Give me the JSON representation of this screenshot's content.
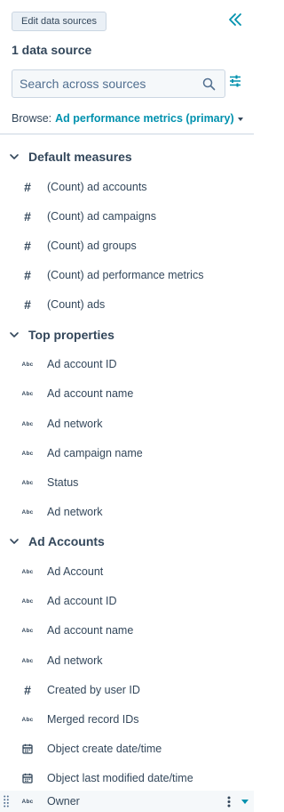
{
  "header": {
    "edit_button_label": "Edit data sources",
    "data_source_count": "1 data source"
  },
  "search": {
    "placeholder": "Search across sources"
  },
  "browse": {
    "label": "Browse:",
    "value": "Ad performance metrics (primary)"
  },
  "sections": [
    {
      "title": "Default measures",
      "items": [
        {
          "icon": "number-icon",
          "label": "(Count) ad accounts"
        },
        {
          "icon": "number-icon",
          "label": "(Count) ad campaigns"
        },
        {
          "icon": "number-icon",
          "label": "(Count) ad groups"
        },
        {
          "icon": "number-icon",
          "label": "(Count) ad performance metrics"
        },
        {
          "icon": "number-icon",
          "label": "(Count) ads"
        }
      ]
    },
    {
      "title": "Top properties",
      "items": [
        {
          "icon": "text-type-icon",
          "label": "Ad account ID"
        },
        {
          "icon": "text-type-icon",
          "label": "Ad account name"
        },
        {
          "icon": "text-type-icon",
          "label": "Ad network"
        },
        {
          "icon": "text-type-icon",
          "label": "Ad campaign name"
        },
        {
          "icon": "text-type-icon",
          "label": "Status"
        },
        {
          "icon": "text-type-icon",
          "label": "Ad network"
        }
      ]
    },
    {
      "title": "Ad Accounts",
      "items": [
        {
          "icon": "text-type-icon",
          "label": "Ad Account"
        },
        {
          "icon": "text-type-icon",
          "label": "Ad account ID"
        },
        {
          "icon": "text-type-icon",
          "label": "Ad account name"
        },
        {
          "icon": "text-type-icon",
          "label": "Ad network"
        },
        {
          "icon": "number-icon",
          "label": "Created by user ID"
        },
        {
          "icon": "text-type-icon",
          "label": "Merged record IDs"
        },
        {
          "icon": "calendar-icon",
          "label": "Object create date/time"
        },
        {
          "icon": "calendar-icon",
          "label": "Object last modified date/time"
        },
        {
          "icon": "text-type-icon",
          "label": "Owner"
        }
      ]
    }
  ],
  "icon_text": {
    "number": "#",
    "text_type": "Abc"
  },
  "colors": {
    "accent": "#0091ae",
    "text": "#33475b",
    "border": "#cbd6e2",
    "button_bg": "#eaf0f6",
    "hover_bg": "#f5f8fa"
  }
}
